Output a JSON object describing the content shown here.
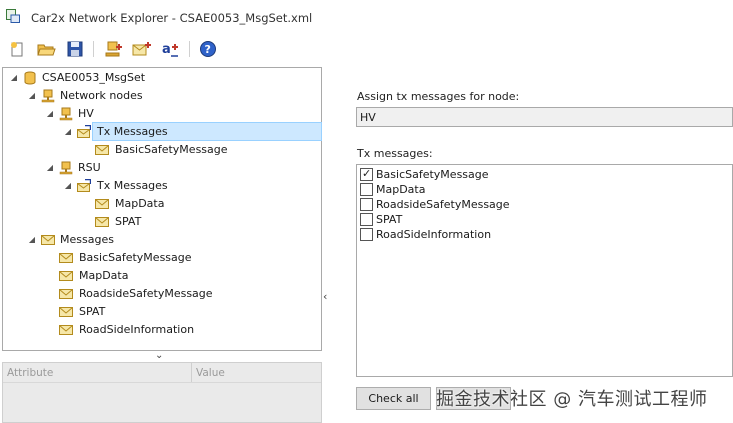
{
  "window": {
    "title": "Car2x Network Explorer - CSAE0053_MsgSet.xml"
  },
  "toolbar": {
    "buttons": [
      "new-icon",
      "open-folder-icon",
      "save-icon",
      "add-node-icon",
      "add-message-icon",
      "rename-icon",
      "help-icon"
    ]
  },
  "tree": {
    "root": "CSAE0053_MsgSet",
    "network_nodes": "Network nodes",
    "hv": "HV",
    "hv_tx": "Tx Messages",
    "hv_tx_items": [
      "BasicSafetyMessage"
    ],
    "rsu": "RSU",
    "rsu_tx": "Tx Messages",
    "rsu_tx_items": [
      "MapData",
      "SPAT"
    ],
    "messages": "Messages",
    "message_items": [
      "BasicSafetyMessage",
      "MapData",
      "RoadsideSafetyMessage",
      "SPAT",
      "RoadSideInformation"
    ]
  },
  "attributes": {
    "col_attribute": "Attribute",
    "col_value": "Value"
  },
  "assign": {
    "label": "Assign tx messages for node:",
    "node_value": "HV",
    "tx_label": "Tx messages:",
    "messages": [
      {
        "name": "BasicSafetyMessage",
        "checked": true
      },
      {
        "name": "MapData",
        "checked": false
      },
      {
        "name": "RoadsideSafetyMessage",
        "checked": false
      },
      {
        "name": "SPAT",
        "checked": false
      },
      {
        "name": "RoadSideInformation",
        "checked": false
      }
    ]
  },
  "buttons": {
    "check_all": "Check all"
  },
  "watermark": "掘金技术社区 @ 汽车测试工程师"
}
